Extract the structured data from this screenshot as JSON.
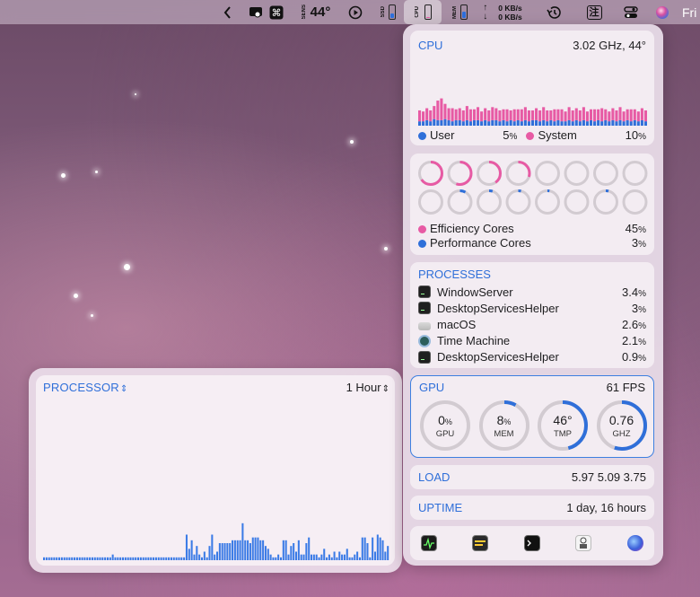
{
  "menubar": {
    "temp_label": "SENS",
    "temp_value": "44°",
    "ssd_label": "SSD",
    "cpu_label": "CPU",
    "mem_label": "MEM",
    "net_up": "0 KB/s",
    "net_down": "0 KB/s",
    "clock_fragment": "Fri",
    "ime_glyph": "注"
  },
  "processor_widget": {
    "title": "PROCESSOR",
    "range": "1 Hour",
    "bars": [
      1,
      1,
      1,
      1,
      1,
      1,
      1,
      1,
      1,
      1,
      1,
      1,
      1,
      1,
      1,
      1,
      1,
      1,
      1,
      1,
      1,
      1,
      1,
      1,
      1,
      1,
      1,
      2,
      1,
      1,
      1,
      1,
      1,
      1,
      1,
      1,
      1,
      1,
      1,
      1,
      1,
      1,
      1,
      1,
      1,
      1,
      1,
      1,
      1,
      1,
      1,
      1,
      1,
      1,
      1,
      1,
      9,
      4,
      7,
      2,
      5,
      2,
      1,
      3,
      1,
      5,
      9,
      2,
      3,
      6,
      6,
      6,
      6,
      6,
      7,
      7,
      7,
      7,
      13,
      7,
      7,
      6,
      8,
      8,
      8,
      7,
      7,
      5,
      4,
      2,
      1,
      1,
      2,
      1,
      7,
      7,
      2,
      5,
      6,
      3,
      7,
      2,
      2,
      6,
      8,
      2,
      2,
      2,
      1,
      2,
      4,
      1,
      2,
      1,
      3,
      1,
      3,
      2,
      2,
      4,
      1,
      1,
      2,
      3,
      1,
      8,
      8,
      6,
      1,
      8,
      3,
      9,
      8,
      7,
      3,
      5
    ]
  },
  "cpu": {
    "title": "CPU",
    "freq": "3.02 GHz, 44°",
    "user_label": "User",
    "user_value": "5",
    "system_label": "System",
    "system_value": "10",
    "user_color": "#2f6fd9",
    "system_color": "#e75aa4",
    "history_user": [
      4,
      4,
      5,
      4,
      6,
      5,
      5,
      6,
      5,
      4,
      5,
      5,
      4,
      5,
      4,
      5,
      5,
      4,
      5,
      4,
      5,
      5,
      4,
      5,
      4,
      5,
      4,
      5,
      4,
      5,
      4,
      5,
      5,
      4,
      5,
      4,
      5,
      4,
      5,
      4,
      4,
      5,
      4,
      5,
      4,
      5,
      4,
      5,
      4,
      5,
      4,
      5,
      4,
      5,
      4,
      5,
      4,
      5,
      4,
      5,
      4,
      5,
      4
    ],
    "history_system": [
      10,
      9,
      11,
      10,
      12,
      18,
      20,
      14,
      11,
      12,
      10,
      11,
      10,
      13,
      11,
      10,
      12,
      9,
      11,
      10,
      12,
      11,
      10,
      10,
      11,
      9,
      11,
      10,
      11,
      12,
      10,
      9,
      11,
      10,
      12,
      10,
      9,
      11,
      10,
      11,
      9,
      12,
      10,
      11,
      10,
      12,
      9,
      10,
      11,
      10,
      12,
      10,
      9,
      11,
      10,
      12,
      9,
      10,
      11,
      10,
      9,
      11,
      10
    ]
  },
  "cores": {
    "efficiency_label": "Efficiency Cores",
    "efficiency_value": "45",
    "performance_label": "Performance Cores",
    "performance_value": "3",
    "loads": [
      65,
      55,
      40,
      30,
      0,
      0,
      0,
      0,
      0,
      8,
      5,
      4,
      3,
      0,
      4,
      0
    ]
  },
  "processes": {
    "title": "PROCESSES",
    "items": [
      {
        "name": "WindowServer",
        "value": "3.4",
        "icon": "terminal-icon"
      },
      {
        "name": "DesktopServicesHelper",
        "value": "3",
        "icon": "terminal-icon"
      },
      {
        "name": "macOS",
        "value": "2.6",
        "icon": "macos-icon"
      },
      {
        "name": "Time Machine",
        "value": "2.1",
        "icon": "time-machine-icon"
      },
      {
        "name": "DesktopServicesHelper",
        "value": "0.9",
        "icon": "terminal-icon"
      }
    ]
  },
  "gpu": {
    "title": "GPU",
    "fps": "61 FPS",
    "gauges": [
      {
        "value": "0",
        "unit": "%",
        "label": "GPU",
        "fill": 0
      },
      {
        "value": "8",
        "unit": "%",
        "label": "MEM",
        "fill": 8
      },
      {
        "value": "46°",
        "unit": "",
        "label": "TMP",
        "fill": 46
      },
      {
        "value": "0.76",
        "unit": "",
        "label": "GHZ",
        "fill": 55
      }
    ]
  },
  "load": {
    "title": "LOAD",
    "value": "5.97 5.09 3.75"
  },
  "uptime": {
    "title": "UPTIME",
    "value": "1 day, 16 hours"
  }
}
